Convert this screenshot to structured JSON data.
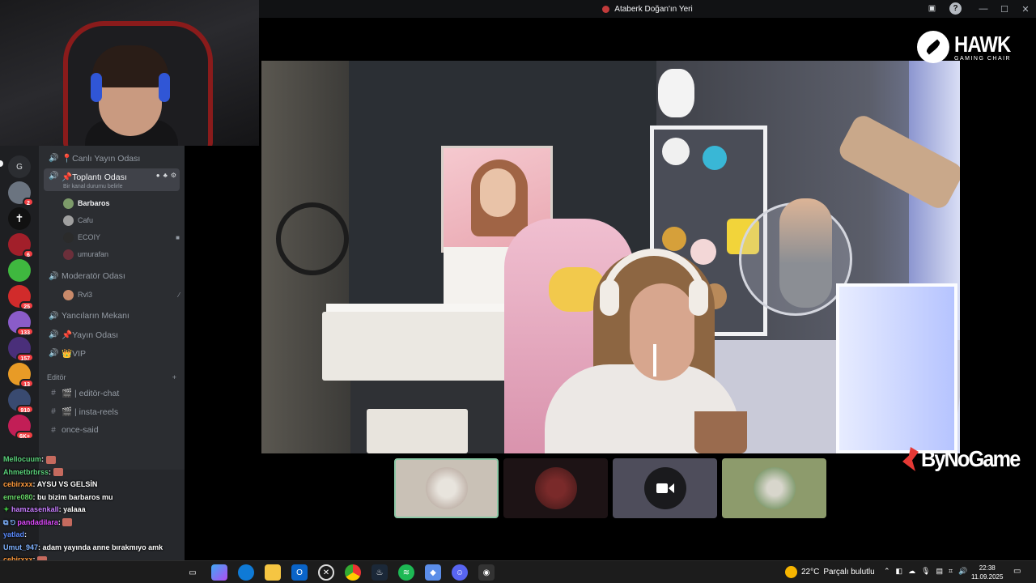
{
  "window": {
    "title": "Ataberk Doğan'ın Yeri",
    "controls": [
      "—",
      "☐",
      "✕"
    ]
  },
  "server_badges": [
    "2",
    "6",
    "25",
    "133",
    "157",
    "13",
    "910",
    "6K+"
  ],
  "channels": {
    "voice_1": "📍Canlı Yayın Odası",
    "active": "📌Toplantı Odası",
    "active_status": "Bir kanal durumu belirle",
    "active_users": [
      "Barbaros",
      "Cafu",
      "ECOIY",
      "umurafan"
    ],
    "mod_room": "Moderatör Odası",
    "mod_users": [
      "Rvl3"
    ],
    "yanci": "Yancıların Mekanı",
    "yayin": "📌Yayın Odası",
    "vip": "👑VIP",
    "category": "Editör",
    "text_1": "🎬 | editör-chat",
    "text_2": "🎬 | insta-reels",
    "text_3": "once-said"
  },
  "chat": [
    {
      "user": "Mellocuum",
      "color": "#5ad17a",
      "text": ":"
    },
    {
      "user": "Ahmetbrbrss",
      "color": "#5ad17a",
      "text": ":"
    },
    {
      "user": "cebirxxx",
      "color": "#ff9a3c",
      "text": ": AYSU VS GELSİN"
    },
    {
      "user": "emre080",
      "color": "#66d466",
      "text": ": bu bizim barbaros mu"
    },
    {
      "user": "hamzasenkall",
      "color": "#c77dff",
      "text": ": yalaaa"
    },
    {
      "user": "pandadilara",
      "color": "#e04bff",
      "text": ":"
    },
    {
      "user": "yatlad",
      "color": "#5b8cff",
      "text": ":"
    },
    {
      "user": "Umut_947",
      "color": "#7fb2ff",
      "text": ": adam yayında anne bırakmıyo amk"
    },
    {
      "user": "cebirxxx",
      "color": "#ff9a3c",
      "text": ":"
    }
  ],
  "logos": {
    "hawk": "HAWK",
    "hawk_sub": "GAMING CHAIR",
    "bynogame": "ByNoGame"
  },
  "taskbar": {
    "weather_temp": "22°C",
    "weather_desc": "Parçalı bulutlu",
    "time": "22:38",
    "date": "11.09.2025"
  },
  "colors": {
    "discord_bg": "#2b2d31",
    "rail_bg": "#1e1f22",
    "badge_red": "#f23f43",
    "thumb_selected_border": "#8cc8a6"
  }
}
